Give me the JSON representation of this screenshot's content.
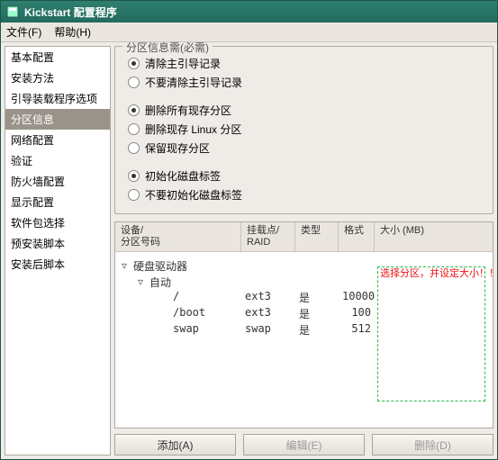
{
  "window": {
    "title": "Kickstart 配置程序"
  },
  "menu": {
    "file": "文件(F)",
    "help": "帮助(H)"
  },
  "sidebar": {
    "items": [
      {
        "label": "基本配置",
        "selected": false
      },
      {
        "label": "安装方法",
        "selected": false
      },
      {
        "label": "引导装载程序选项",
        "selected": false
      },
      {
        "label": "分区信息",
        "selected": true
      },
      {
        "label": "网络配置",
        "selected": false
      },
      {
        "label": "验证",
        "selected": false
      },
      {
        "label": "防火墙配置",
        "selected": false
      },
      {
        "label": "显示配置",
        "selected": false
      },
      {
        "label": "软件包选择",
        "selected": false
      },
      {
        "label": "预安装脚本",
        "selected": false
      },
      {
        "label": "安装后脚本",
        "selected": false
      }
    ]
  },
  "groupbox": {
    "legend": "分区信息需(必需)"
  },
  "radios": {
    "mbr": [
      {
        "label": "清除主引导记录",
        "on": true
      },
      {
        "label": "不要清除主引导记录",
        "on": false
      }
    ],
    "part": [
      {
        "label": "删除所有现存分区",
        "on": true
      },
      {
        "label": "删除现存 Linux 分区",
        "on": false
      },
      {
        "label": "保留现存分区",
        "on": false
      }
    ],
    "label": [
      {
        "label": "初始化磁盘标签",
        "on": true
      },
      {
        "label": "不要初始化磁盘标签",
        "on": false
      }
    ]
  },
  "table": {
    "headers": {
      "c1": "设备/\n分区号码",
      "c2": "挂载点/\nRAID",
      "c3": "类型",
      "c4": "格式",
      "c5": "大小 (MB)"
    },
    "tree": {
      "root": "硬盘驱动器",
      "auto": "自动"
    },
    "rows": [
      {
        "mount": "/",
        "type": "ext3",
        "fmt": "是",
        "size": "10000"
      },
      {
        "mount": "/boot",
        "type": "ext3",
        "fmt": "是",
        "size": "100"
      },
      {
        "mount": "swap",
        "type": "swap",
        "fmt": "是",
        "size": "512"
      }
    ]
  },
  "annotation": "选择分区，并设定大小！！",
  "buttons": {
    "add": "添加(A)",
    "edit": "编辑(E)",
    "del": "删除(D)"
  }
}
